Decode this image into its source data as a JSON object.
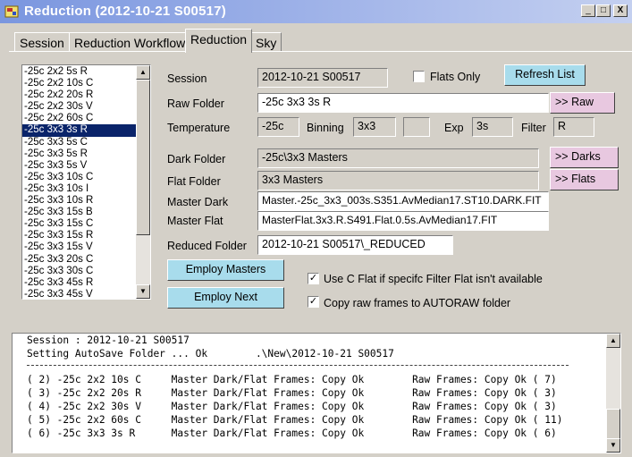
{
  "window": {
    "title": "Reduction (2012-10-21 S00517)",
    "min": "_",
    "max": "□",
    "close": "X"
  },
  "tabs": [
    {
      "label": "Session"
    },
    {
      "label": "Reduction Workflow"
    },
    {
      "label": "Reduction"
    },
    {
      "label": "Sky"
    }
  ],
  "frame_list": [
    "-25c 2x2 5s R",
    "-25c 2x2 10s C",
    "-25c 2x2 20s R",
    "-25c 2x2 30s V",
    "-25c 2x2 60s C",
    "-25c 3x3 3s R",
    "-25c 3x3 5s C",
    "-25c 3x3 5s R",
    "-25c 3x3 5s V",
    "-25c 3x3 10s C",
    "-25c 3x3 10s I",
    "-25c 3x3 10s R",
    "-25c 3x3 15s B",
    "-25c 3x3 15s C",
    "-25c 3x3 15s R",
    "-25c 3x3 15s V",
    "-25c 3x3 20s C",
    "-25c 3x3 30s C",
    "-25c 3x3 45s R",
    "-25c 3x3 45s V"
  ],
  "selected_frame": "-25c 3x3 3s R",
  "session": {
    "label": "Session",
    "value": "2012-10-21 S00517"
  },
  "flats_only": {
    "label": "Flats Only",
    "checked": false
  },
  "refresh_button": "Refresh List",
  "raw_folder": {
    "label": "Raw Folder",
    "value": "-25c 3x3 3s R",
    "button": ">> Raw"
  },
  "temperature": {
    "label": "Temperature",
    "value": "-25c"
  },
  "binning": {
    "label": "Binning",
    "value": "3x3",
    "extra": ""
  },
  "exp": {
    "label": "Exp",
    "value": "3s"
  },
  "filter": {
    "label": "Filter",
    "value": "R"
  },
  "dark_folder": {
    "label": "Dark Folder",
    "value": "-25c\\3x3 Masters",
    "button": ">> Darks"
  },
  "flat_folder": {
    "label": "Flat Folder",
    "value": "3x3 Masters",
    "button": ">> Flats"
  },
  "master_dark": {
    "label": "Master Dark",
    "value": "Master.-25c_3x3_003s.S351.AvMedian17.ST10.DARK.FIT"
  },
  "master_flat": {
    "label": "Master Flat",
    "value": "MasterFlat.3x3.R.S491.Flat.0.5s.AvMedian17.FIT"
  },
  "reduced_folder": {
    "label": "Reduced Folder",
    "value": "2012-10-21 S00517\\_REDUCED"
  },
  "employ_masters": "Employ Masters",
  "employ_next": "Employ Next",
  "use_c_flat": {
    "label": "Use C Flat if specifc Filter Flat isn't available",
    "checked": true
  },
  "copy_raw": {
    "label": "Copy raw frames to AUTORAW folder",
    "checked": true
  },
  "log": [
    "Session : 2012-10-21 S00517",
    "Setting AutoSave Folder ... Ok        .\\New\\2012-10-21 S00517",
    "( 2) -25c 2x2 10s C     Master Dark/Flat Frames: Copy Ok        Raw Frames: Copy Ok ( 7)",
    "( 3) -25c 2x2 20s R     Master Dark/Flat Frames: Copy Ok        Raw Frames: Copy Ok ( 3)",
    "( 4) -25c 2x2 30s V     Master Dark/Flat Frames: Copy Ok        Raw Frames: Copy Ok ( 3)",
    "( 5) -25c 2x2 60s C     Master Dark/Flat Frames: Copy Ok        Raw Frames: Copy Ok ( 11)",
    "( 6) -25c 3x3 3s R      Master Dark/Flat Frames: Copy Ok        Raw Frames: Copy Ok ( 6)"
  ],
  "colors": {
    "selection": "#0a246a",
    "blue_button": "#a8dcec",
    "pink_button": "#e8c8e0",
    "titlebar": "#7a96df"
  }
}
